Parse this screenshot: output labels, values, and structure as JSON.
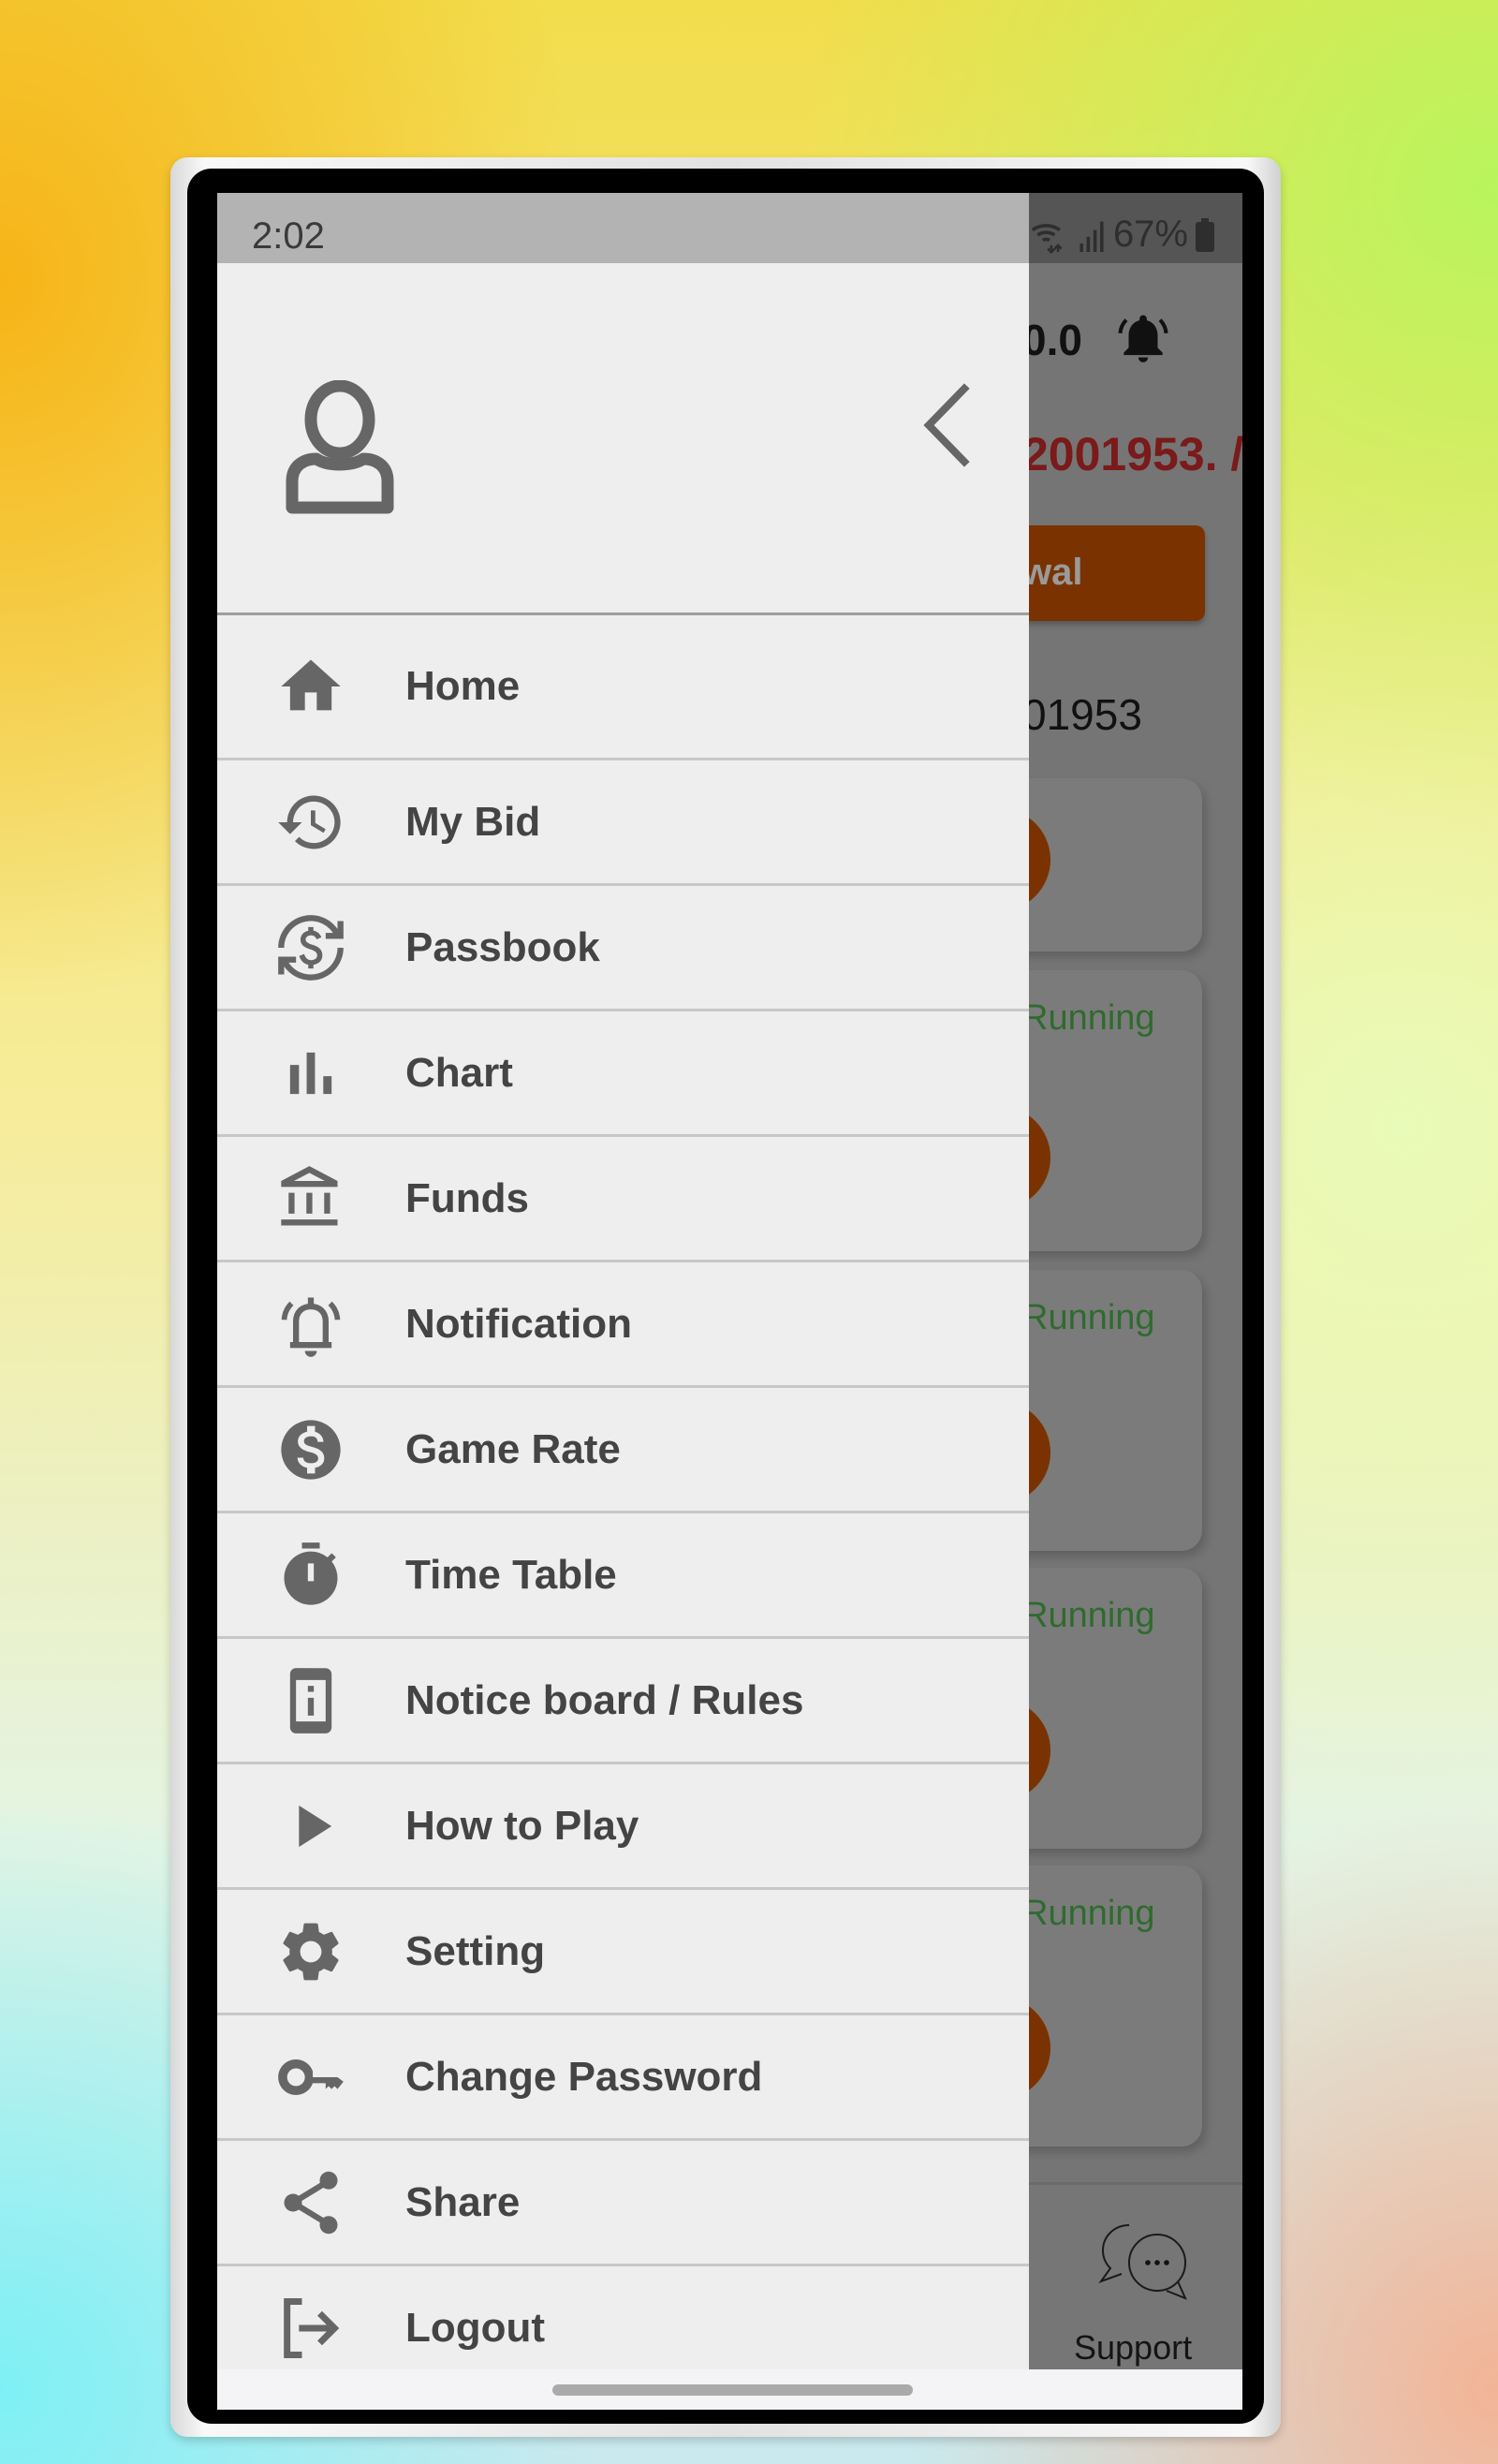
{
  "status_bar": {
    "time": "2:02",
    "battery": "67%",
    "icons": [
      "wifi-icon",
      "signal-icon",
      "battery-icon"
    ]
  },
  "drawer": {
    "avatar_icon": "user-icon",
    "close_icon": "chevron-left-icon",
    "items": [
      {
        "label": "Home",
        "icon": "home-icon"
      },
      {
        "label": "My Bid",
        "icon": "history-icon"
      },
      {
        "label": "Passbook",
        "icon": "currency-exchange-icon"
      },
      {
        "label": "Chart",
        "icon": "bar-chart-icon"
      },
      {
        "label": "Funds",
        "icon": "bank-icon"
      },
      {
        "label": "Notification",
        "icon": "bell-ringing-icon"
      },
      {
        "label": "Game Rate",
        "icon": "dollar-circle-icon"
      },
      {
        "label": "Time Table",
        "icon": "stopwatch-icon"
      },
      {
        "label": "Notice board / Rules",
        "icon": "info-device-icon"
      },
      {
        "label": "How to Play",
        "icon": "play-icon"
      },
      {
        "label": "Setting",
        "icon": "gear-icon"
      },
      {
        "label": "Change Password",
        "icon": "key-icon"
      },
      {
        "label": "Share",
        "icon": "share-icon"
      },
      {
        "label": "Logout",
        "icon": "logout-icon"
      }
    ]
  },
  "background_app": {
    "balance_partial": "0.0",
    "user_id_partial": "2001953. /",
    "withdraw_partial": "wal",
    "id_partial": "01953",
    "card_status": "Running",
    "support_label": "Support"
  },
  "colors": {
    "drawer_bg": "#eeeeee",
    "icon_gray": "#666666",
    "label_gray": "#444444",
    "accent_orange_dimmed": "#7a3300",
    "running_green_dimmed": "#2e6b2e",
    "id_red_dimmed": "#7a1a1a"
  }
}
